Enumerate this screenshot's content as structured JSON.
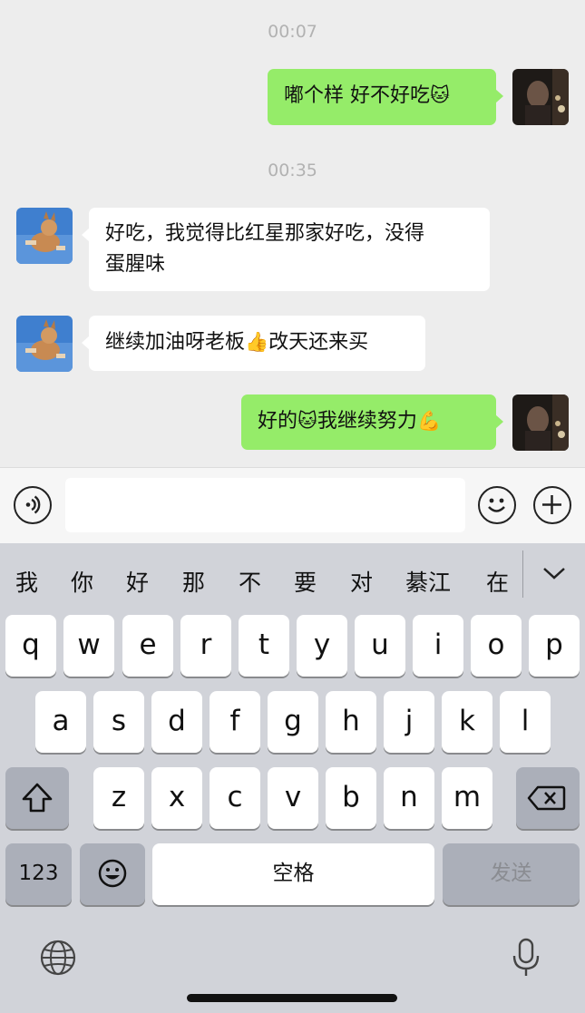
{
  "chat": {
    "timestamps": [
      "00:07",
      "00:35"
    ],
    "messages": [
      {
        "from": "me",
        "text": "嘟个样 好不好吃",
        "emoji": "🐱"
      },
      {
        "from": "other",
        "line1": "好吃，我觉得比红星那家好吃，没得",
        "line2": "蛋腥味"
      },
      {
        "from": "other",
        "text": "继续加油呀老板",
        "emoji": "👍",
        "text2": "改天还来买"
      },
      {
        "from": "me",
        "text": "好的",
        "emoji": "🐱",
        "text2": "我继续努力",
        "emoji2": "💪"
      }
    ]
  },
  "input": {
    "placeholder": ""
  },
  "keyboard": {
    "candidates": [
      "我",
      "你",
      "好",
      "那",
      "不",
      "要",
      "对",
      "綦江",
      "在"
    ],
    "row1": [
      "q",
      "w",
      "e",
      "r",
      "t",
      "y",
      "u",
      "i",
      "o",
      "p"
    ],
    "row2": [
      "a",
      "s",
      "d",
      "f",
      "g",
      "h",
      "j",
      "k",
      "l"
    ],
    "row3": [
      "z",
      "x",
      "c",
      "v",
      "b",
      "n",
      "m"
    ],
    "numbers_label": "123",
    "space_label": "空格",
    "send_label": "发送"
  },
  "icons": {
    "voice": "voice-icon",
    "emoji": "emoji-icon",
    "add": "plus-icon",
    "shift": "shift-icon",
    "backspace": "backspace-icon",
    "globe": "globe-icon",
    "mic": "microphone-icon",
    "collapse": "chevron-down-icon"
  },
  "colors": {
    "outgoing_bubble": "#95ec69",
    "incoming_bubble": "#ffffff",
    "chat_bg": "#ededed",
    "keyboard_bg": "#d1d3d9"
  }
}
